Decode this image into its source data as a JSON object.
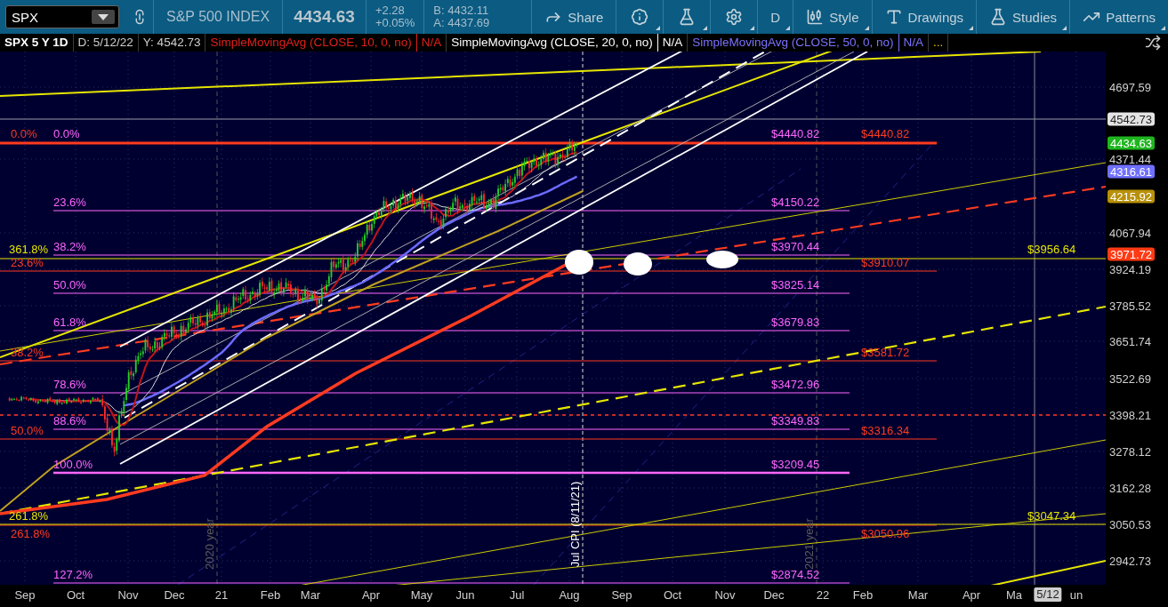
{
  "toolbar": {
    "symbol": "SPX",
    "description": "S&P 500 INDEX",
    "last": "4434.63",
    "change": "+2.28",
    "change_pct": "+0.05%",
    "bid": "B: 4432.11",
    "ask": "A: 4437.69",
    "buttons": [
      {
        "kind": "share",
        "label": "Share"
      },
      {
        "kind": "info"
      },
      {
        "kind": "flask"
      },
      {
        "kind": "gear"
      },
      {
        "kind": "text",
        "label": "D"
      },
      {
        "kind": "style",
        "label": "Style"
      },
      {
        "kind": "drawings",
        "label": "Drawings"
      },
      {
        "kind": "studies",
        "label": "Studies"
      },
      {
        "kind": "patterns",
        "label": "Patterns"
      }
    ]
  },
  "legend": {
    "title": "SPX 5 Y 1D",
    "date": "D: 5/12/22",
    "y": "Y: 4542.73",
    "studies": [
      {
        "name": "SimpleMovingAvg (CLOSE, 10, 0, no)",
        "value": "N/A",
        "color": "#e0201c"
      },
      {
        "name": "SimpleMovingAvg (CLOSE, 20, 0, no)",
        "value": "N/A",
        "color": "#ffffff"
      },
      {
        "name": "SimpleMovingAvg (CLOSE, 50, 0, no)",
        "value": "N/A",
        "color": "#7b72ff"
      }
    ],
    "more": "..."
  },
  "chart": {
    "fib_sets": [
      {
        "color": "#ff66ff",
        "levels": [
          {
            "percent": "0.0%",
            "price": "$4440.82"
          },
          {
            "percent": "23.6%",
            "price": "$4150.22"
          },
          {
            "percent": "38.2%",
            "price": "$3970.44"
          },
          {
            "percent": "50.0%",
            "price": "$3825.14"
          },
          {
            "percent": "61.8%",
            "price": "$3679.83"
          },
          {
            "percent": "78.6%",
            "price": "$3472.96"
          },
          {
            "percent": "88.6%",
            "price": "$3349.83"
          },
          {
            "percent": "100.0%",
            "price": "$3209.45"
          },
          {
            "percent": "127.2%",
            "price": "$2874.52"
          }
        ]
      },
      {
        "color": "#ff3b1f",
        "levels": [
          {
            "percent": "0.0%",
            "price": "$4440.82"
          },
          {
            "percent": "23.6%",
            "price": "$3910.07"
          },
          {
            "percent": "38.2%",
            "price": "$3581.72"
          },
          {
            "percent": "50.0%",
            "price": "$3316.34"
          },
          {
            "percent": "261.8%",
            "price": "$3050.96"
          }
        ]
      },
      {
        "color": "#e6e600",
        "levels": [
          {
            "percent": "361.8%",
            "price": "$3956.64"
          },
          {
            "percent": "261.8%",
            "price": "$3047.34"
          }
        ]
      }
    ],
    "year_marks": [
      "2020 year",
      "2021 year"
    ],
    "event": "Jul CPI (8/11/21)"
  },
  "price_axis": {
    "ticks": [
      "4697.59",
      "4371.44",
      "4067.94",
      "3924.19",
      "3785.52",
      "3651.74",
      "3522.69",
      "3398.21",
      "3278.12",
      "3162.28",
      "3050.53",
      "2942.73"
    ],
    "badges": [
      {
        "value": "4542.73",
        "color": "#e4e4e4"
      },
      {
        "value": "4434.63",
        "color": "#1fb51f"
      },
      {
        "value": "4316.61",
        "color": "#7070ff"
      },
      {
        "value": "4215.92",
        "color": "#b8900a"
      },
      {
        "value": "3971.72",
        "color": "#ff3a14"
      }
    ]
  },
  "time_axis": {
    "labels": [
      "Sep",
      "Oct",
      "Nov",
      "Dec",
      "21",
      "Feb",
      "Mar",
      "Apr",
      "May",
      "Jun",
      "Jul",
      "Aug",
      "Sep",
      "Oct",
      "Nov",
      "Dec",
      "22",
      "Feb",
      "Mar",
      "Apr",
      "Ma",
      "un"
    ],
    "cursor": "5/12"
  }
}
